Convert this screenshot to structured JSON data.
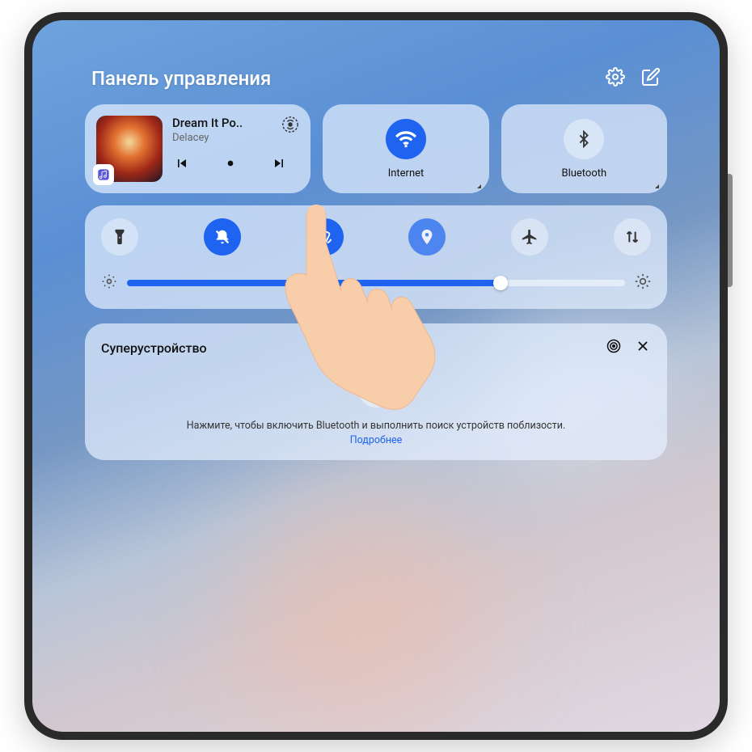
{
  "header": {
    "title": "Панель управления"
  },
  "music": {
    "title": "Dream It Po..",
    "artist": "Delacey"
  },
  "tiles": {
    "internet": {
      "label": "Internet",
      "active": true
    },
    "bluetooth": {
      "label": "Bluetooth",
      "active": false
    }
  },
  "toggles": [
    {
      "name": "flashlight",
      "active": false
    },
    {
      "name": "mute",
      "active": true
    },
    {
      "name": "auto-rotate",
      "active": true
    },
    {
      "name": "location",
      "active": true
    },
    {
      "name": "airplane",
      "active": false
    },
    {
      "name": "data-swap",
      "active": false
    }
  ],
  "brightness": {
    "percent": 75
  },
  "superdevice": {
    "title": "Суперустройство",
    "prompt": "Нажмите, чтобы включить Bluetooth и выполнить поиск устройств поблизости.",
    "link": "Подробнее"
  },
  "colors": {
    "accent": "#1e64f0"
  }
}
